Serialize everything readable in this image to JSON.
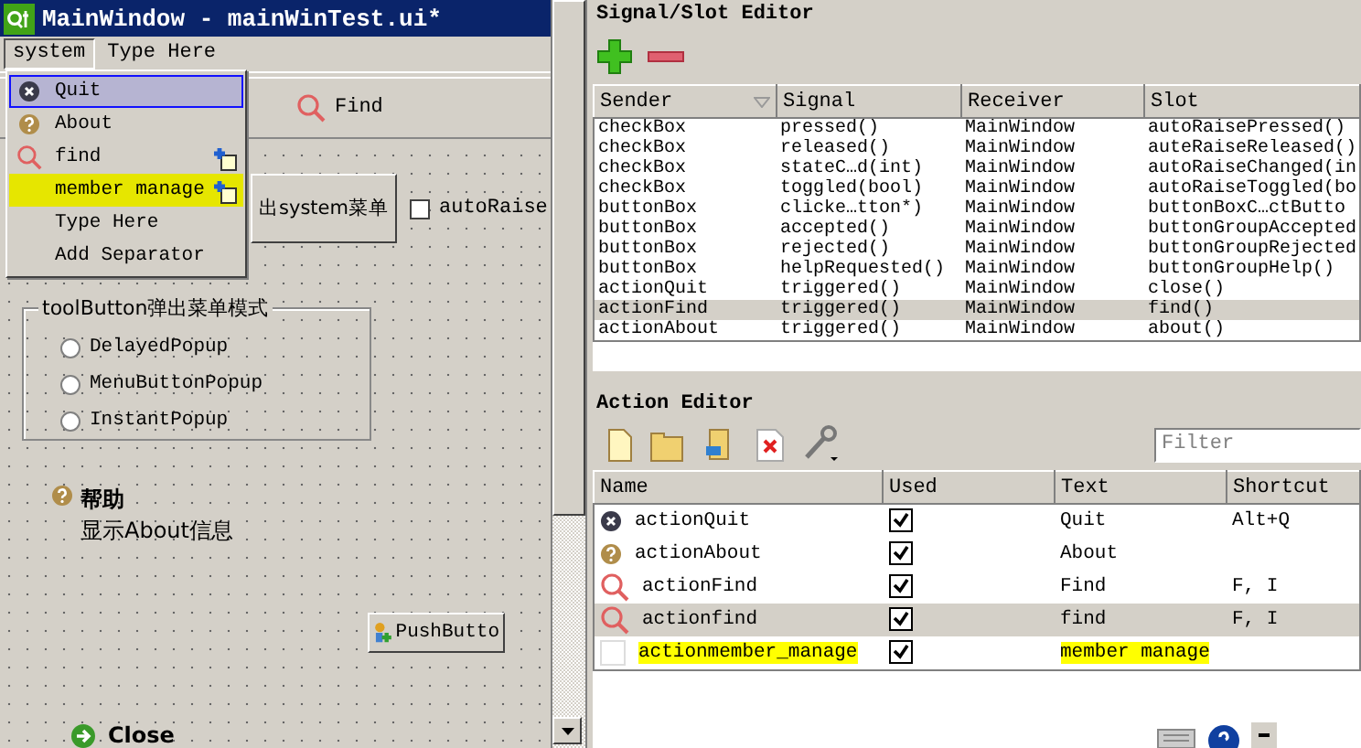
{
  "window": {
    "title": "MainWindow - mainWinTest.ui*"
  },
  "menubar": [
    {
      "label": "system",
      "selected": true
    },
    {
      "label": "Type Here",
      "selected": false
    }
  ],
  "menu": {
    "items": [
      {
        "label": "Quit",
        "kind": "quit",
        "selected": true,
        "highlighted": false,
        "add_badge": false
      },
      {
        "label": "About",
        "kind": "about",
        "selected": false,
        "highlighted": false,
        "add_badge": false
      },
      {
        "label": "find",
        "kind": "find",
        "selected": false,
        "highlighted": false,
        "add_badge": true
      },
      {
        "label": "member manage",
        "kind": "plain",
        "selected": false,
        "highlighted": true,
        "add_badge": true
      },
      {
        "label": "Type Here",
        "kind": "plain",
        "selected": false,
        "highlighted": false,
        "add_badge": false
      },
      {
        "label": "Add Separator",
        "kind": "plain",
        "selected": false,
        "highlighted": false,
        "add_badge": false
      }
    ]
  },
  "toolbar": [
    {
      "label": "Find",
      "kind": "find"
    }
  ],
  "form": {
    "menu_button": {
      "label": "出system菜单"
    },
    "auto_raise": {
      "label": "autoRaise",
      "checked": false
    },
    "group": {
      "title": "toolButton弹出菜单模式",
      "options": [
        {
          "label": "DelayedPopup",
          "selected": false
        },
        {
          "label": "MenuButtonPopup",
          "selected": false
        },
        {
          "label": "InstantPopup",
          "selected": false
        }
      ]
    },
    "help": {
      "title": "帮助",
      "text": "显示About信息"
    },
    "push_button": {
      "label": "PushButto"
    },
    "close": {
      "label": "Close"
    }
  },
  "signal_slot_editor": {
    "title": "Signal/Slot Editor",
    "table": {
      "columns": [
        "Sender",
        "Signal",
        "Receiver",
        "Slot"
      ],
      "rows": [
        {
          "cells": [
            "checkBox",
            "pressed()",
            "MainWindow",
            "autoRaisePressed()"
          ],
          "selected": false
        },
        {
          "cells": [
            "checkBox",
            "released()",
            "MainWindow",
            "auteRaiseReleased()"
          ],
          "selected": false
        },
        {
          "cells": [
            "checkBox",
            "stateC…d(int)",
            "MainWindow",
            "autoRaiseChanged(in"
          ],
          "selected": false
        },
        {
          "cells": [
            "checkBox",
            "toggled(bool)",
            "MainWindow",
            "autoRaiseToggled(bo"
          ],
          "selected": false
        },
        {
          "cells": [
            "buttonBox",
            "clicke…tton*)",
            "MainWindow",
            "buttonBoxC…ctButto"
          ],
          "selected": false
        },
        {
          "cells": [
            "buttonBox",
            "accepted()",
            "MainWindow",
            "buttonGroupAccepted"
          ],
          "selected": false
        },
        {
          "cells": [
            "buttonBox",
            "rejected()",
            "MainWindow",
            "buttonGroupRejected"
          ],
          "selected": false
        },
        {
          "cells": [
            "buttonBox",
            "helpRequested()",
            "MainWindow",
            "buttonGroupHelp()"
          ],
          "selected": false
        },
        {
          "cells": [
            "actionQuit",
            "triggered()",
            "MainWindow",
            "close()"
          ],
          "selected": false
        },
        {
          "cells": [
            "actionFind",
            "triggered()",
            "MainWindow",
            "find()"
          ],
          "selected": true
        },
        {
          "cells": [
            "actionAbout",
            "triggered()",
            "MainWindow",
            "about()"
          ],
          "selected": false
        }
      ]
    }
  },
  "action_editor": {
    "title": "Action Editor",
    "filter": {
      "placeholder": "Filter"
    },
    "table": {
      "columns": [
        "Name",
        "Used",
        "Text",
        "Shortcut"
      ],
      "rows": [
        {
          "kind": "quit",
          "name": "actionQuit",
          "used": true,
          "text": "Quit",
          "shortcut": "Alt+Q",
          "selected": false,
          "highlighted": false
        },
        {
          "kind": "about",
          "name": "actionAbout",
          "used": true,
          "text": "About",
          "selected": false,
          "highlighted": false
        },
        {
          "kind": "find",
          "name": "actionFind",
          "used": true,
          "text": "Find",
          "shortcut": "F, I",
          "selected": false,
          "highlighted": false
        },
        {
          "kind": "find",
          "name": "actionfind",
          "used": true,
          "text": "find",
          "shortcut": "F, I",
          "selected": true,
          "highlighted": false
        },
        {
          "kind": "plain",
          "name": "actionmember_manage",
          "used": true,
          "text": "member manage",
          "selected": false,
          "highlighted": true
        }
      ]
    }
  }
}
